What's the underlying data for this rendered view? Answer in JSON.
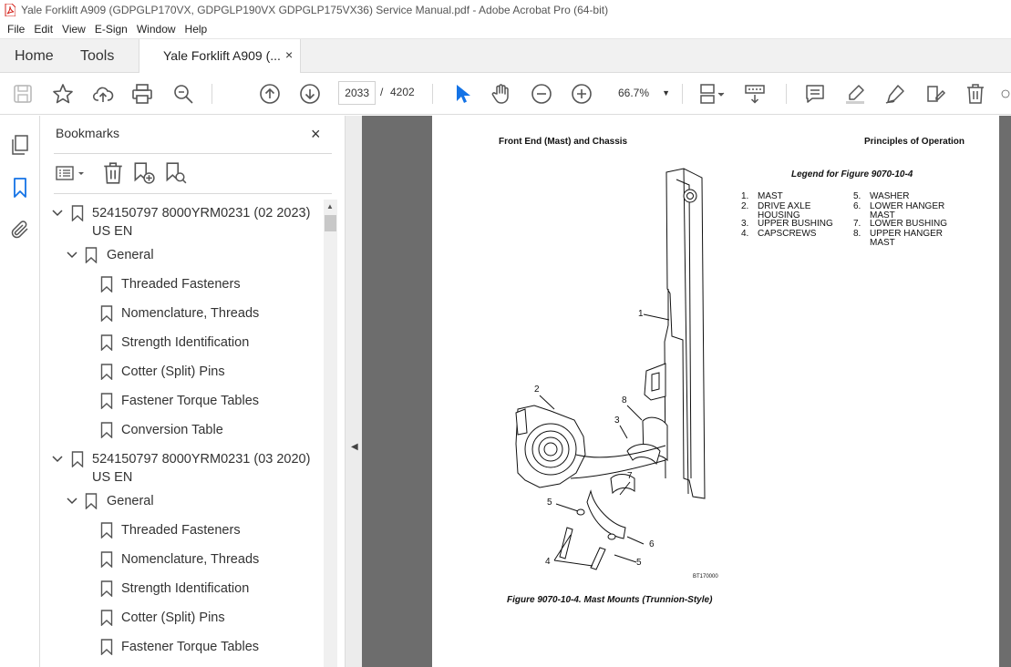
{
  "window": {
    "title": "Yale Forklift A909 (GDPGLP170VX, GDPGLP190VX GDPGLP175VX36) Service Manual.pdf - Adobe Acrobat Pro (64-bit)"
  },
  "menu": [
    "File",
    "Edit",
    "View",
    "E-Sign",
    "Window",
    "Help"
  ],
  "tabs": {
    "home": "Home",
    "tools": "Tools",
    "document": "Yale Forklift A909 (...",
    "close": "×"
  },
  "toolbar": {
    "current_page": "2033",
    "page_separator": "/",
    "total_pages": "4202",
    "zoom": "66.7%"
  },
  "bookmarks": {
    "title": "Bookmarks",
    "close": "×",
    "items": [
      {
        "level": 0,
        "expanded": true,
        "label": "524150797 8000YRM0231 (02 2023)",
        "label2": "US EN"
      },
      {
        "level": 1,
        "expanded": true,
        "label": "General"
      },
      {
        "level": 2,
        "label": "Threaded Fasteners"
      },
      {
        "level": 2,
        "label": "Nomenclature, Threads"
      },
      {
        "level": 2,
        "label": "Strength Identification"
      },
      {
        "level": 2,
        "label": "Cotter (Split) Pins"
      },
      {
        "level": 2,
        "label": "Fastener Torque Tables"
      },
      {
        "level": 2,
        "label": "Conversion Table"
      },
      {
        "level": 0,
        "expanded": true,
        "label": "524150797 8000YRM0231 (03 2020)",
        "label2": "US EN"
      },
      {
        "level": 1,
        "expanded": true,
        "label": "General"
      },
      {
        "level": 2,
        "label": "Threaded Fasteners"
      },
      {
        "level": 2,
        "label": "Nomenclature, Threads"
      },
      {
        "level": 2,
        "label": "Strength Identification"
      },
      {
        "level": 2,
        "label": "Cotter (Split) Pins"
      },
      {
        "level": 2,
        "label": "Fastener Torque Tables"
      }
    ]
  },
  "document": {
    "header_left": "Front End (Mast) and Chassis",
    "header_right": "Principles of Operation",
    "legend_title": "Legend for Figure 9070-10-4",
    "legend_col1": [
      {
        "num": "1.",
        "text": "MAST"
      },
      {
        "num": "2.",
        "text": "DRIVE AXLE HOUSING"
      },
      {
        "num": "3.",
        "text": "UPPER BUSHING"
      },
      {
        "num": "4.",
        "text": "CAPSCREWS"
      }
    ],
    "legend_col2": [
      {
        "num": "5.",
        "text": "WASHER"
      },
      {
        "num": "6.",
        "text": "LOWER HANGER MAST"
      },
      {
        "num": "7.",
        "text": "LOWER BUSHING"
      },
      {
        "num": "8.",
        "text": "UPPER HANGER MAST"
      }
    ],
    "callouts": {
      "c1": "1",
      "c2": "2",
      "c3": "3",
      "c4": "4",
      "c5a": "5",
      "c5b": "5",
      "c6": "6",
      "c7": "7",
      "c8": "8"
    },
    "figure_code": "BT170000",
    "caption": "Figure 9070-10-4. Mast Mounts (Trunnion-Style)"
  },
  "colors": {
    "accent_blue": "#1473e6",
    "acrobat_red": "#d4241c",
    "doc_background": "#6d6d6d"
  }
}
